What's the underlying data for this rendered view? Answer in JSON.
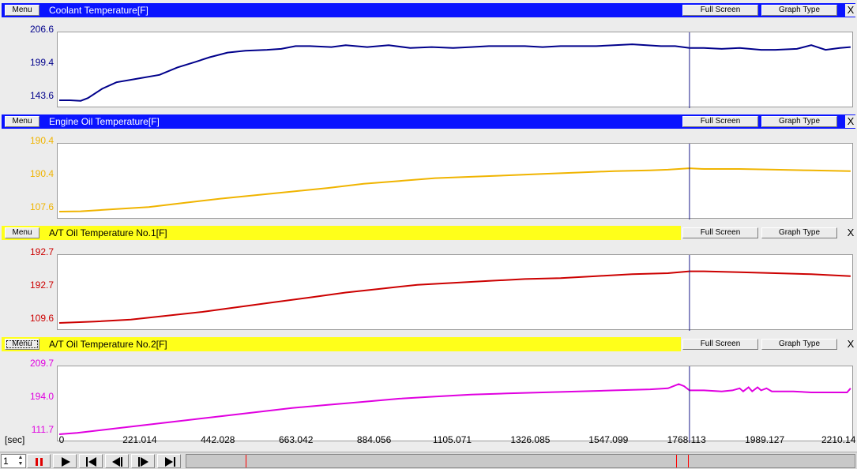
{
  "panels": [
    {
      "title": "Coolant Temperature[F]",
      "bar": "blue",
      "menu_label": "Menu",
      "fullscreen_label": "Full Screen",
      "graphtype_label": "Graph Type",
      "close_label": "X",
      "color": "#00008b",
      "y_labels": [
        "206.6",
        "199.4",
        "143.6"
      ],
      "series": [
        [
          0,
          143.6
        ],
        [
          30,
          143.6
        ],
        [
          60,
          143.0
        ],
        [
          80,
          146
        ],
        [
          120,
          156
        ],
        [
          160,
          163
        ],
        [
          220,
          167
        ],
        [
          280,
          171
        ],
        [
          330,
          179
        ],
        [
          380,
          185
        ],
        [
          420,
          190
        ],
        [
          470,
          195
        ],
        [
          520,
          197
        ],
        [
          580,
          198
        ],
        [
          620,
          199
        ],
        [
          660,
          202
        ],
        [
          700,
          202
        ],
        [
          760,
          201
        ],
        [
          800,
          203
        ],
        [
          860,
          201
        ],
        [
          920,
          203
        ],
        [
          980,
          200
        ],
        [
          1040,
          201
        ],
        [
          1100,
          200
        ],
        [
          1150,
          201
        ],
        [
          1200,
          202
        ],
        [
          1240,
          202
        ],
        [
          1300,
          202
        ],
        [
          1350,
          201
        ],
        [
          1400,
          202
        ],
        [
          1450,
          202
        ],
        [
          1500,
          202
        ],
        [
          1550,
          203
        ],
        [
          1600,
          204
        ],
        [
          1640,
          203
        ],
        [
          1680,
          202
        ],
        [
          1720,
          202
        ],
        [
          1760,
          200
        ],
        [
          1800,
          200
        ],
        [
          1850,
          199
        ],
        [
          1900,
          200
        ],
        [
          1960,
          198
        ],
        [
          2000,
          198
        ],
        [
          2060,
          199
        ],
        [
          2100,
          203
        ],
        [
          2140,
          198
        ],
        [
          2180,
          200
        ],
        [
          2210,
          201
        ]
      ],
      "ymin": 143.6,
      "ymax": 206.6
    },
    {
      "title": "Engine Oil Temperature[F]",
      "bar": "blue",
      "menu_label": "Menu",
      "fullscreen_label": "Full Screen",
      "graphtype_label": "Graph Type",
      "close_label": "X",
      "color": "#f0b400",
      "y_labels": [
        "190.4",
        "190.4",
        "107.6"
      ],
      "series": [
        [
          0,
          107.6
        ],
        [
          60,
          108
        ],
        [
          150,
          111
        ],
        [
          250,
          114
        ],
        [
          350,
          120
        ],
        [
          450,
          126
        ],
        [
          550,
          131
        ],
        [
          650,
          136
        ],
        [
          750,
          141
        ],
        [
          850,
          147
        ],
        [
          950,
          151
        ],
        [
          1050,
          155
        ],
        [
          1150,
          157
        ],
        [
          1250,
          159
        ],
        [
          1350,
          161
        ],
        [
          1450,
          163
        ],
        [
          1550,
          165
        ],
        [
          1650,
          166
        ],
        [
          1700,
          167
        ],
        [
          1760,
          169
        ],
        [
          1800,
          168
        ],
        [
          1900,
          168
        ],
        [
          2000,
          167
        ],
        [
          2100,
          166
        ],
        [
          2210,
          165
        ]
      ],
      "ymin": 107.6,
      "ymax": 190.4
    },
    {
      "title": "A/T Oil Temperature No.1[F]",
      "bar": "yellow",
      "menu_label": "Menu",
      "fullscreen_label": "Full Screen",
      "graphtype_label": "Graph Type",
      "close_label": "X",
      "color": "#cc0000",
      "y_labels": [
        "192.7",
        "192.7",
        "109.6"
      ],
      "series": [
        [
          0,
          109.6
        ],
        [
          100,
          111
        ],
        [
          200,
          113
        ],
        [
          300,
          117
        ],
        [
          400,
          121
        ],
        [
          500,
          126
        ],
        [
          600,
          131
        ],
        [
          700,
          136
        ],
        [
          800,
          141
        ],
        [
          900,
          145
        ],
        [
          1000,
          149
        ],
        [
          1100,
          151
        ],
        [
          1200,
          153
        ],
        [
          1300,
          155
        ],
        [
          1400,
          156
        ],
        [
          1500,
          158
        ],
        [
          1600,
          160
        ],
        [
          1700,
          161
        ],
        [
          1760,
          163
        ],
        [
          1800,
          163
        ],
        [
          1900,
          162
        ],
        [
          2000,
          161
        ],
        [
          2100,
          160
        ],
        [
          2210,
          158
        ]
      ],
      "ymin": 109.6,
      "ymax": 170
    },
    {
      "title": "A/T Oil Temperature No.2[F]",
      "bar": "yellow",
      "menu_label": "Menu",
      "fullscreen_label": "Full Screen",
      "graphtype_label": "Graph Type",
      "close_label": "X",
      "color": "#e000e0",
      "menu_focused": true,
      "y_labels": [
        "209.7",
        "194.0",
        "111.7"
      ],
      "series": [
        [
          0,
          111.7
        ],
        [
          50,
          113
        ],
        [
          150,
          117
        ],
        [
          250,
          121
        ],
        [
          350,
          125
        ],
        [
          450,
          129
        ],
        [
          550,
          133
        ],
        [
          650,
          137
        ],
        [
          750,
          140
        ],
        [
          850,
          143
        ],
        [
          950,
          146
        ],
        [
          1050,
          148
        ],
        [
          1150,
          150
        ],
        [
          1250,
          151
        ],
        [
          1350,
          152
        ],
        [
          1450,
          153
        ],
        [
          1550,
          154
        ],
        [
          1650,
          155
        ],
        [
          1700,
          156
        ],
        [
          1730,
          160
        ],
        [
          1745,
          158
        ],
        [
          1760,
          154
        ],
        [
          1800,
          154
        ],
        [
          1850,
          153
        ],
        [
          1880,
          154
        ],
        [
          1900,
          156
        ],
        [
          1910,
          153
        ],
        [
          1925,
          157
        ],
        [
          1935,
          153
        ],
        [
          1950,
          157
        ],
        [
          1960,
          154
        ],
        [
          1975,
          156
        ],
        [
          1990,
          153
        ],
        [
          2050,
          153
        ],
        [
          2100,
          152
        ],
        [
          2150,
          152
        ],
        [
          2200,
          152
        ],
        [
          2210,
          156
        ]
      ],
      "ymin": 111.7,
      "ymax": 168
    }
  ],
  "cursor_x": 1760,
  "x_axis": {
    "unit_label": "[sec]",
    "ticks": [
      "0",
      "221.014",
      "442.028",
      "663.042",
      "884.056",
      "1105.071",
      "1326.085",
      "1547.099",
      "1768.113",
      "1989.127",
      "2210.14"
    ],
    "max": 2210.14
  },
  "controls": {
    "spin_value": "1",
    "markers": [
      310,
      855,
      870
    ]
  }
}
